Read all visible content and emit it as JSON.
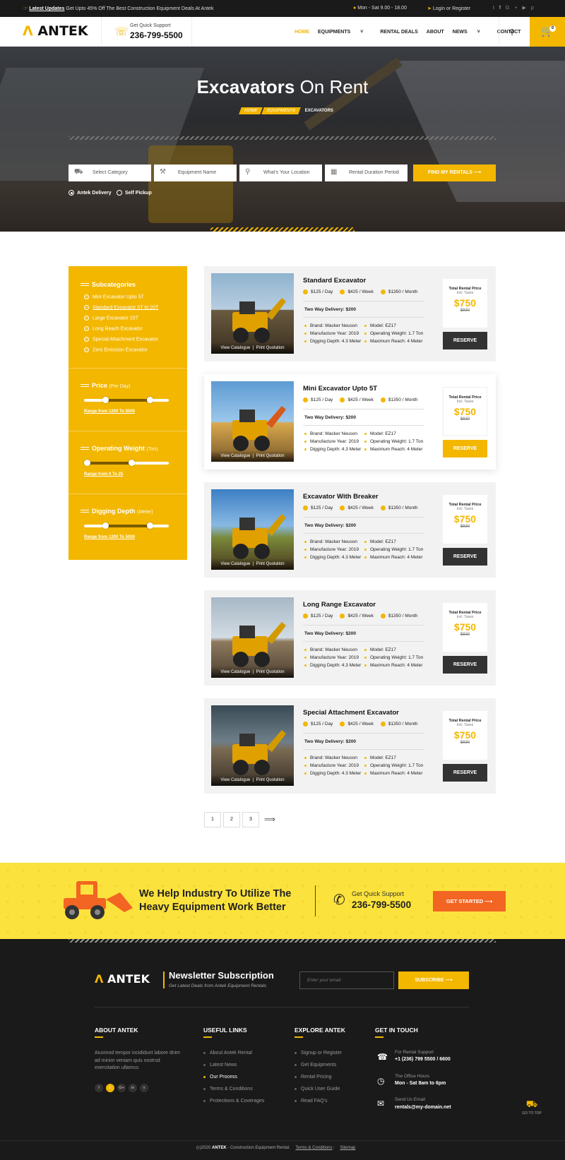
{
  "topbar": {
    "latest_label": "Latest Updates",
    "latest_text": "Get Upto 45% Off The Best Construction Equipment Deals At Antek",
    "hours": "Mon - Sat  9.00 - 18.00",
    "login": "Login or Register"
  },
  "header": {
    "logo": "ANTEK",
    "support_label": "Get Quick Support",
    "support_phone": "236-799-5500",
    "cart_count": "0",
    "nav": [
      "HOME",
      "EQUIPMENTS",
      "RENTAL DEALS",
      "ABOUT",
      "NEWS",
      "CONTACT"
    ]
  },
  "hero": {
    "title_bold": "Excavators",
    "title_thin": "On Rent",
    "crumbs": [
      "HOME",
      "EQUIPMENTS",
      "EXCAVATORS"
    ],
    "fields": [
      "Select Category",
      "Equipment Name",
      "What's Your Location",
      "Rental Duration Period"
    ],
    "find_btn": "FIND MY RENTALS",
    "radio1": "Antek Delivery",
    "radio2": "Self Pickup"
  },
  "sidebar": {
    "subcat_title": "Subcategories",
    "subcats": [
      "Mini Excavator Upto 5T",
      "Standard Excavator 5T to 20T",
      "Large Excavator 20T",
      "Long Reach Excavator",
      "Special Attachment Excavator",
      "Zero Emission Excavator"
    ],
    "price_title": "Price",
    "price_sub": "(Per Day)",
    "price_range": "Range from 1200 To 5000",
    "weight_title": "Operating Weight",
    "weight_sub": "(Ton)",
    "weight_range": "Range from 0 To 25",
    "depth_title": "Digging Depth",
    "depth_sub": "(Meter)",
    "depth_range": "Range from 1200 To 5000",
    "price_slider": {
      "low": 0.23,
      "high": 0.8
    },
    "weight_slider": {
      "low": 0,
      "high": 0.57
    },
    "depth_slider": {
      "low": 0.23,
      "high": 0.8
    }
  },
  "products": [
    {
      "name": "Standard Excavator",
      "day": "$125 / Day",
      "week": "$425 / Week",
      "month": "$1350 / Month",
      "delivery": "Two Way Delivery: $200",
      "brand": "Brand: Wacker Neuson",
      "model": "Model: EZ17",
      "year": "Manufacture Year: 2019",
      "weight": "Operating Weight: 1.7 Ton",
      "depth": "Digging Depth: 4.3 Meter",
      "reach": "Maximum Reach: 4 Meter",
      "total_label": "Total Rental Price",
      "taxes": "Incl. Taxes",
      "price": "$750",
      "old": "$830",
      "btn": "RESERVE",
      "cat": "View Catalogue",
      "quote": "Print Quotation"
    },
    {
      "name": "Mini Excavator Upto 5T",
      "day": "$125 / Day",
      "week": "$425 / Week",
      "month": "$1350 / Month",
      "delivery": "Two Way Delivery: $200",
      "brand": "Brand: Wacker Neuson",
      "model": "Model: EZ17",
      "year": "Manufacture Year: 2019",
      "weight": "Operating Weight: 1.7 Ton",
      "depth": "Digging Depth: 4.3 Meter",
      "reach": "Maximum Reach: 4 Meter",
      "total_label": "Total Rental Price",
      "taxes": "Incl. Taxes",
      "price": "$750",
      "old": "$830",
      "btn": "RESERVE",
      "cat": "View Catalogue",
      "quote": "Print Quotation"
    },
    {
      "name": "Excavator With Breaker",
      "day": "$125 / Day",
      "week": "$425 / Week",
      "month": "$1350 / Month",
      "delivery": "Two Way Delivery: $200",
      "brand": "Brand: Wacker Neuson",
      "model": "Model: EZ17",
      "year": "Manufacture Year: 2019",
      "weight": "Operating Weight: 1.7 Ton",
      "depth": "Digging Depth: 4.3 Meter",
      "reach": "Maximum Reach: 4 Meter",
      "total_label": "Total Rental Price",
      "taxes": "Incl. Taxes",
      "price": "$750",
      "old": "$830",
      "btn": "RESERVE",
      "cat": "View Catalogue",
      "quote": "Print Quotation"
    },
    {
      "name": "Long Range Excavator",
      "day": "$125 / Day",
      "week": "$425 / Week",
      "month": "$1350 / Month",
      "delivery": "Two Way Delivery: $200",
      "brand": "Brand: Wacker Neuson",
      "model": "Model: EZ17",
      "year": "Manufacture Year: 2019",
      "weight": "Operating Weight: 1.7 Ton",
      "depth": "Digging Depth: 4.3 Meter",
      "reach": "Maximum Reach: 4 Meter",
      "total_label": "Total Rental Price",
      "taxes": "Incl. Taxes",
      "price": "$750",
      "old": "$830",
      "btn": "RESERVE",
      "cat": "View Catalogue",
      "quote": "Print Quotation"
    },
    {
      "name": "Special Attachment Excavator",
      "day": "$125 / Day",
      "week": "$425 / Week",
      "month": "$1350 / Month",
      "delivery": "Two Way Delivery: $200",
      "brand": "Brand: Wacker Neuson",
      "model": "Model: EZ17",
      "year": "Manufacture Year: 2019",
      "weight": "Operating Weight: 1.7 Ton",
      "depth": "Digging Depth: 4.3 Meter",
      "reach": "Maximum Reach: 4 Meter",
      "total_label": "Total Rental Price",
      "taxes": "Incl. Taxes",
      "price": "$750",
      "old": "$830",
      "btn": "RESERVE",
      "cat": "View Catalogue",
      "quote": "Print Quotation"
    }
  ],
  "pagination": [
    "1",
    "2",
    "3"
  ],
  "cta": {
    "heading": "We Help Industry To Utilize The Heavy Equipment Work Better",
    "support_label": "Get Quick Support",
    "phone": "236-799-5500",
    "btn": "GET STARTED"
  },
  "footer": {
    "logo": "ANTEK",
    "news_title": "Newsletter Subscription",
    "news_sub": "Get Latest Deals from Antek Equipment Rentals",
    "email_placeholder": "Enter your email",
    "subscribe": "SUBSCRIBE",
    "about_title": "ABOUT ANTEK",
    "about_text": "Aiusmod tempor incididunt labore dnim ad minim veniam quis nostrsd exercitation ullamco.",
    "useful_title": "USEFUL LINKS",
    "useful": [
      "About Antek Rental",
      "Latest News",
      "Our Process",
      "Terms & Conditions",
      "Protections & Coverages"
    ],
    "explore_title": "EXPLORE ANTEK",
    "explore": [
      "Signup or Register",
      "Get Equipments",
      "Rental Pricing",
      "Quick User Guide",
      "Read FAQ's"
    ],
    "touch_title": "GET IN TOUCH",
    "touch": [
      {
        "label": "For Rental Support",
        "value": "+1 (236) 799 5500 / 6600"
      },
      {
        "label": "The Office Hours",
        "value": "Mon - Sat 8am to 6pm"
      },
      {
        "label": "Send Us Email",
        "value": "rentals@my-domain.net"
      }
    ],
    "copy_pre": "(c)2020",
    "copy_brand": "ANTEK",
    "copy_post": "- Construction Equipment Rental.",
    "terms": "Terms & Conditions",
    "sitemap": "Sitemap",
    "gotop": "GO TO TOP"
  },
  "colors": {
    "accent": "#f3b700",
    "dark": "#1a1a1a",
    "cta_bg": "#fce23c",
    "orange": "#f26522"
  }
}
